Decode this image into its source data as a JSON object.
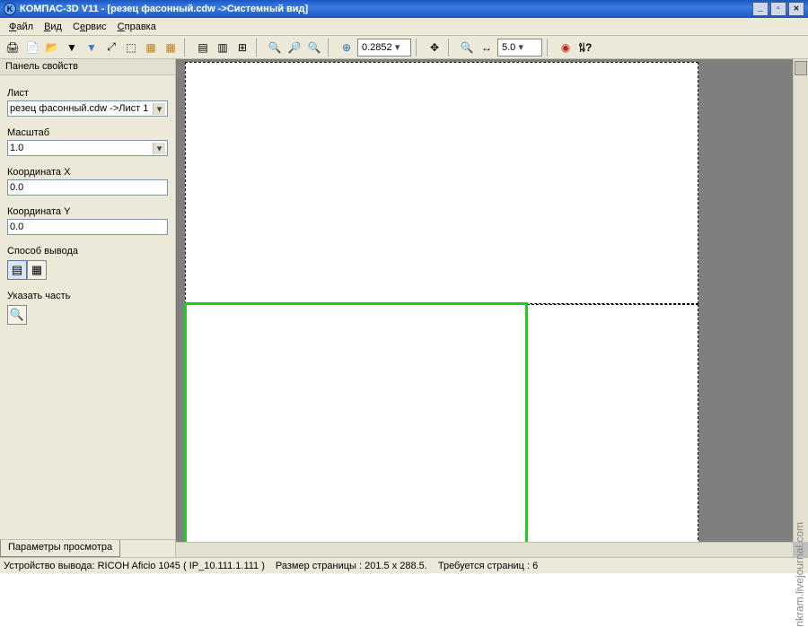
{
  "title": "КОМПАС-3D V11 - [резец фасонный.cdw ->Системный вид]",
  "win": {
    "min": "_",
    "max": "❐",
    "close": "✕",
    "restore": "▫"
  },
  "menu": {
    "file": "Файл",
    "view": "Вид",
    "service": "Сервис",
    "help": "Справка"
  },
  "toolbar": {
    "zoom_value": "0.2852",
    "dist_value": "5.0",
    "icons": {
      "print": "🖨",
      "preview": "📄",
      "open": "📂",
      "filter": "▼",
      "zoomfit": "⤢",
      "zoomsel": "⬚",
      "tile": "▦",
      "tile2": "▤",
      "tile3": "▥",
      "tilegrid": "⊞",
      "zoomin": "🔍",
      "zoomout": "🔍",
      "zoom1": "⊕",
      "hand": "✥",
      "search": "🔍",
      "measure": "↔",
      "red": "◉",
      "help": "?"
    }
  },
  "panel": {
    "title": "Панель свойств",
    "sheet_label": "Лист",
    "sheet_value": "резец фасонный.cdw ->Лист 1",
    "scale_label": "Масштаб",
    "scale_value": "1.0",
    "coordx_label": "Координата X",
    "coordx_value": "0.0",
    "coordy_label": "Координата Y",
    "coordy_value": "0.0",
    "output_label": "Способ вывода",
    "part_label": "Указать часть",
    "tab": "Параметры просмотра"
  },
  "status": {
    "device": "Устройство вывода: RICOH Aficio 1045 ( IP_10.111.1.111 )",
    "pagesize": "Размер страницы : 201.5 x 288.5.",
    "needed": "Требуется страниц : 6"
  },
  "watermark": "nkram.livejournal.com",
  "colors": {
    "accent": "#18d018",
    "titlebar": "#1a56c4",
    "panel": "#ece9d8"
  }
}
